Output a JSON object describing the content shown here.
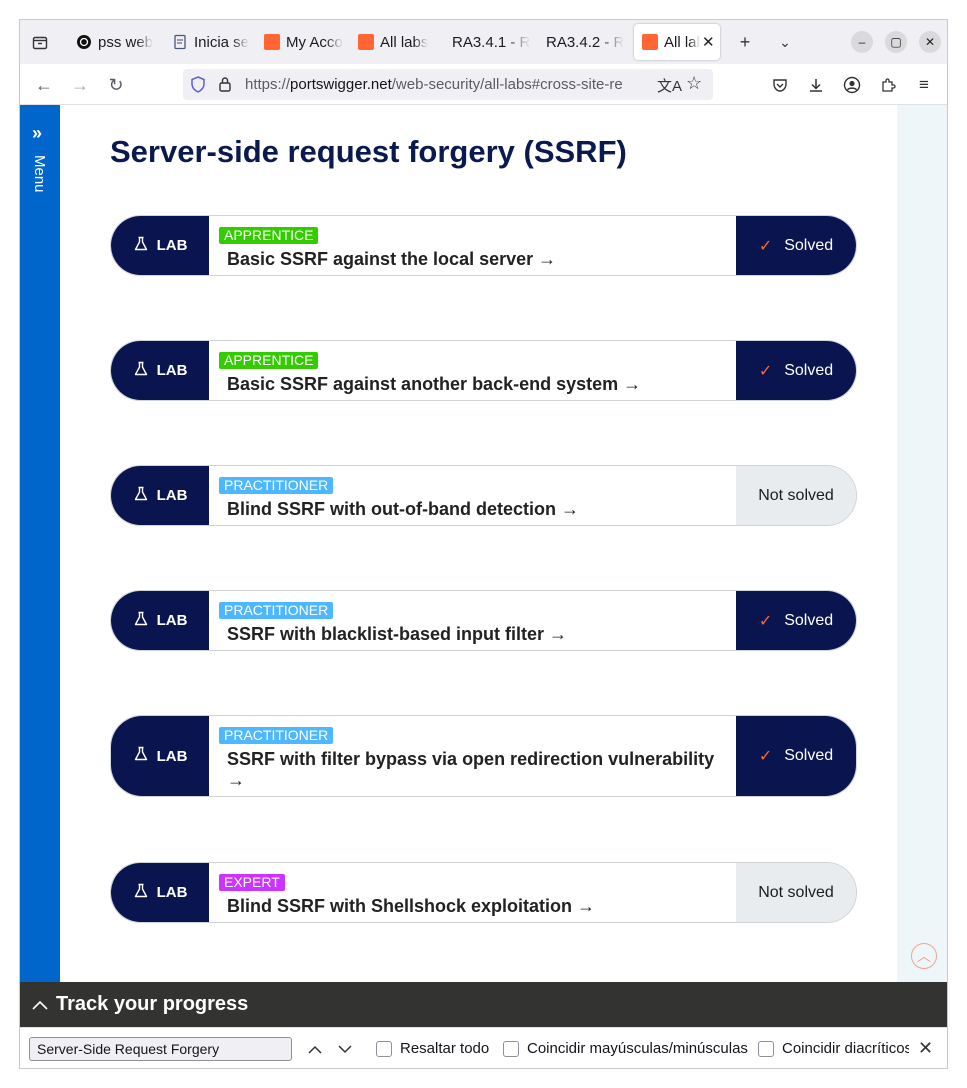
{
  "tabs": [
    {
      "title": "pss web",
      "icon": "chatgpt-icon"
    },
    {
      "title": "Inicia se",
      "icon": "document-icon"
    },
    {
      "title": "My Acco",
      "icon": "portswigger-icon"
    },
    {
      "title": "All labs",
      "icon": "portswigger-icon"
    },
    {
      "title": "RA3.4.1 - R",
      "icon": ""
    },
    {
      "title": "RA3.4.2 - R",
      "icon": ""
    },
    {
      "title": "All lab",
      "icon": "portswigger-icon",
      "active": true
    }
  ],
  "url": {
    "prefix": "https://",
    "host": "portswigger.net",
    "path": "/web-security/all-labs#cross-site-re"
  },
  "sidebar": {
    "menu_label": "Menu"
  },
  "page": {
    "heading": "Server-side request forgery (SSRF)",
    "lab_badge": "LAB",
    "labs": [
      {
        "level": "APPRENTICE",
        "title": "Basic SSRF against the local server →",
        "status": "Solved"
      },
      {
        "level": "APPRENTICE",
        "title": "Basic SSRF against another back-end system →",
        "status": "Solved"
      },
      {
        "level": "PRACTITIONER",
        "title": "Blind SSRF with out-of-band detection →",
        "status": "Not solved"
      },
      {
        "level": "PRACTITIONER",
        "title": "SSRF with blacklist-based input filter →",
        "status": "Solved"
      },
      {
        "level": "PRACTITIONER",
        "title": "SSRF with filter bypass via open redirection vulnerability →",
        "status": "Solved"
      },
      {
        "level": "EXPERT",
        "title": "Blind SSRF with Shellshock exploitation →",
        "status": "Not solved"
      }
    ]
  },
  "progress": {
    "label": "Track your progress"
  },
  "findbar": {
    "query": "Server-Side Request Forgery",
    "highlight_all": "Resaltar todo",
    "match_case": "Coincidir mayúsculas/minúsculas",
    "match_diacritics": "Coincidir diacríticos"
  },
  "colors": {
    "navy": "#0a1550",
    "brand_blue": "#0066cc",
    "apprentice": "#33cc00",
    "practitioner": "#4db8ff",
    "expert": "#cc33ff",
    "check": "#ff6633"
  }
}
